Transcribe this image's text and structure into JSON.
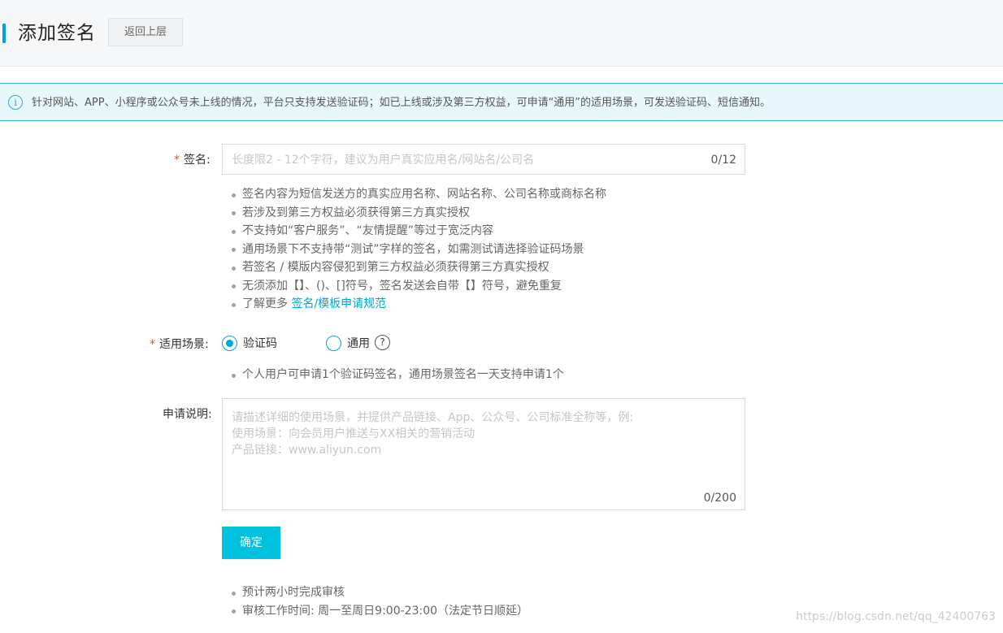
{
  "header": {
    "title": "添加签名",
    "back_label": "返回上层"
  },
  "notice": {
    "icon": "info-icon",
    "icon_glyph": "i",
    "text": "针对网站、APP、小程序或公众号未上线的情况，平台只支持发送验证码；如已上线或涉及第三方权益，可申请“通用”的适用场景，可发送验证码、短信通知。"
  },
  "form": {
    "required_mark": "*",
    "signature": {
      "label": "签名:",
      "placeholder": "长度限2 - 12个字符，建议为用户真实应用名/网站名/公司名",
      "count": "0/12"
    },
    "signature_tips": [
      "签名内容为短信发送方的真实应用名称、网站名称、公司名称或商标名称",
      "若涉及到第三方权益必须获得第三方真实授权",
      "不支持如“客户服务”、“友情提醒”等过于宽泛内容",
      "通用场景下不支持带“测试”字样的签名，如需测试请选择验证码场景",
      "若签名 / 模版内容侵犯到第三方权益必须获得第三方真实授权",
      "无须添加【】、()、[]符号，签名发送会自带【】符号，避免重复"
    ],
    "learn_more": {
      "prefix": "了解更多 ",
      "link": "签名/模板申请规范"
    },
    "scene": {
      "label": "适用场景:",
      "options": [
        {
          "label": "验证码",
          "checked": true
        },
        {
          "label": "通用",
          "checked": false
        }
      ],
      "help_glyph": "?",
      "tip": "个人用户可申请1个验证码签名，通用场景签名一天支持申请1个"
    },
    "description": {
      "label": "申请说明:",
      "placeholder": "请描述详细的使用场景，并提供产品链接、App、公众号、公司标准全称等，例:\n使用场景：向会员用户推送与XX相关的营销活动\n产品链接：www.aliyun.com",
      "count": "0/200"
    },
    "submit_label": "确定",
    "footer_tips": [
      "预计两小时完成审核",
      "审核工作时间: 周一至周日9:00-23:00（法定节日顺延）"
    ]
  },
  "watermark": "https://blog.csdn.net/qq_42400763",
  "colors": {
    "accent": "#00c1de",
    "link": "#00a6d8",
    "required": "#e8541e",
    "notice_bg": "#e8f7fc"
  }
}
